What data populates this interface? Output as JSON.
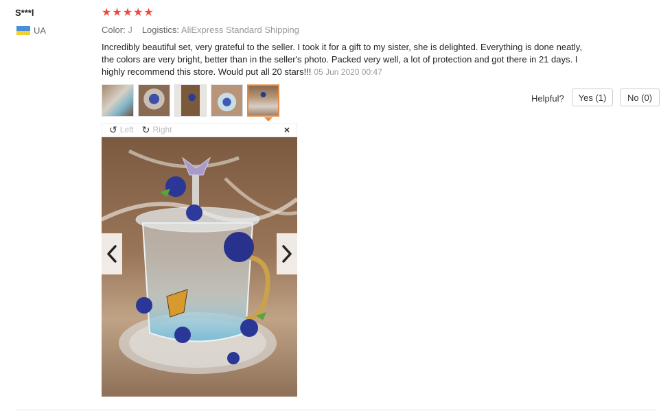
{
  "reviewer": {
    "name": "S***l",
    "country_code": "UA",
    "flag_colors": [
      "#4a8fd6",
      "#f2d12b"
    ]
  },
  "rating": {
    "stars": 5,
    "max": 5,
    "star_glyph": "★",
    "color": "#f0483e"
  },
  "meta": {
    "color_label": "Color:",
    "color_value": "J",
    "logistics_label": "Logistics:",
    "logistics_value": "AliExpress Standard Shipping"
  },
  "review": {
    "text": "Incredibly beautiful set, very grateful to the seller. I took it for a gift to my sister, she is delighted. Everything is done neatly, the colors are very bright, better than in the seller's photo. Packed very well, a lot of protection and got there in 21 days. I highly recommend this store. Would put all 20 stars!!!",
    "date": "05 Jun 2020 00:47"
  },
  "thumbnails": [
    {
      "selected": false
    },
    {
      "selected": false
    },
    {
      "selected": false
    },
    {
      "selected": false
    },
    {
      "selected": true
    }
  ],
  "viewer": {
    "rotate_left_label": "Left",
    "rotate_right_label": "Right",
    "rotate_left_icon": "↺",
    "rotate_right_icon": "↻",
    "close_icon": "×",
    "prev_icon": "chevron-left-icon",
    "next_icon": "chevron-right-icon"
  },
  "helpful": {
    "label": "Helpful?",
    "yes_label": "Yes (1)",
    "no_label": "No (0)"
  },
  "accent_color": "#e88a3f"
}
